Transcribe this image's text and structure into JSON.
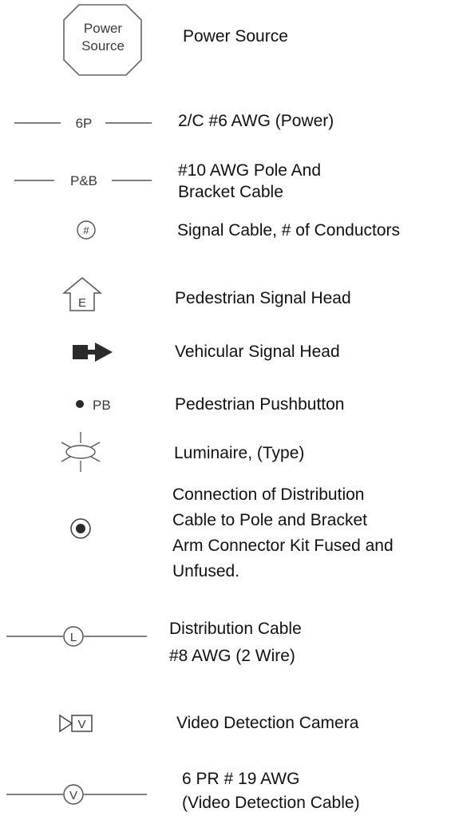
{
  "legend": {
    "items": [
      {
        "symbol_text": [
          "Power",
          "Source"
        ],
        "icon": "octagon-icon",
        "label": "Power Source"
      },
      {
        "symbol_text": "6P",
        "icon": "power-cable-line-icon",
        "label": "2/C #6 AWG (Power)"
      },
      {
        "symbol_text": "P&B",
        "icon": "pole-bracket-cable-line-icon",
        "label_lines": [
          "#10 AWG Pole And",
          "Bracket Cable"
        ]
      },
      {
        "symbol_text": "#",
        "icon": "circle-number-icon",
        "label": "Signal Cable, # of Conductors"
      },
      {
        "symbol_text": "E",
        "icon": "house-shape-icon",
        "label": "Pedestrian Signal Head"
      },
      {
        "icon": "vehicular-signal-icon",
        "label": "Vehicular Signal Head"
      },
      {
        "symbol_text": "PB",
        "icon": "dot-icon",
        "label": "Pedestrian Pushbutton"
      },
      {
        "icon": "luminaire-icon",
        "label": "Luminaire, (Type)"
      },
      {
        "icon": "bullseye-icon",
        "label_lines": [
          "Connection of Distribution",
          "Cable to Pole and Bracket",
          "Arm Connector Kit Fused and",
          "Unfused."
        ]
      },
      {
        "symbol_text": "L",
        "icon": "circle-letter-line-icon",
        "label_lines": [
          "Distribution Cable",
          "#8 AWG (2 Wire)"
        ]
      },
      {
        "symbol_text": "V",
        "icon": "camera-icon",
        "label": "Video Detection Camera"
      },
      {
        "symbol_text": "V",
        "icon": "circle-letter-line-icon",
        "label_lines": [
          "6 PR # 19 AWG",
          "(Video Detection Cable)"
        ]
      }
    ]
  }
}
